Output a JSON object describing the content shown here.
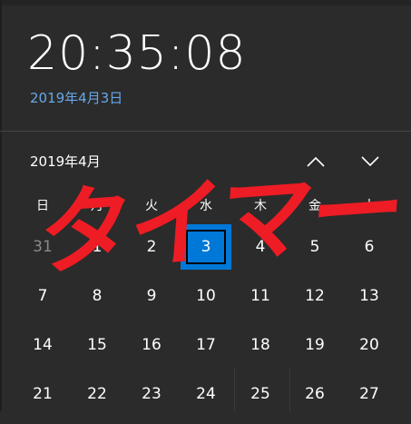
{
  "clock": {
    "time": "20:35:08",
    "long_date": "2019年4月3日"
  },
  "calendar": {
    "month_label": "2019年4月",
    "prev_icon": "chevron-up-icon",
    "next_icon": "chevron-down-icon",
    "weekdays": [
      "日",
      "月",
      "火",
      "水",
      "木",
      "金",
      "土"
    ],
    "weeks": [
      [
        {
          "label": "31",
          "other": true
        },
        {
          "label": "1"
        },
        {
          "label": "2"
        },
        {
          "label": "3",
          "today": true
        },
        {
          "label": "4"
        },
        {
          "label": "5"
        },
        {
          "label": "6"
        }
      ],
      [
        {
          "label": "7"
        },
        {
          "label": "8"
        },
        {
          "label": "9"
        },
        {
          "label": "10"
        },
        {
          "label": "11"
        },
        {
          "label": "12"
        },
        {
          "label": "13"
        }
      ],
      [
        {
          "label": "14"
        },
        {
          "label": "15"
        },
        {
          "label": "16"
        },
        {
          "label": "17"
        },
        {
          "label": "18"
        },
        {
          "label": "19"
        },
        {
          "label": "20"
        }
      ],
      [
        {
          "label": "21"
        },
        {
          "label": "22"
        },
        {
          "label": "23"
        },
        {
          "label": "24"
        },
        {
          "label": "25"
        },
        {
          "label": "26"
        },
        {
          "label": "27"
        }
      ]
    ]
  },
  "overlay": {
    "text": "タイマー",
    "color": "#ee1c24"
  },
  "colors": {
    "background": "#2b2b2b",
    "accent": "#0078d7",
    "date_link": "#66a8e8",
    "other_month": "#8a8a8a"
  }
}
